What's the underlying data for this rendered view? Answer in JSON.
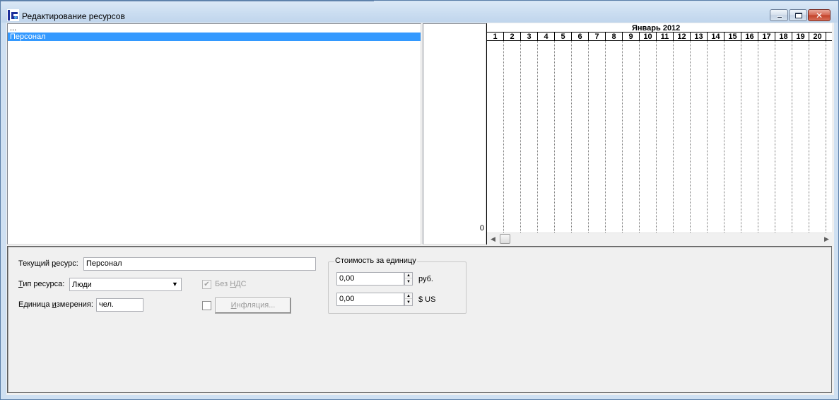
{
  "window": {
    "title": "Редактирование ресурсов"
  },
  "resource_list": {
    "items": [
      {
        "label": "...",
        "selected": false
      },
      {
        "label": "Персонал",
        "selected": true
      }
    ]
  },
  "value_column": {
    "zero_label": "0"
  },
  "gantt": {
    "month_label": "Январь 2012",
    "days": [
      "1",
      "2",
      "3",
      "4",
      "5",
      "6",
      "7",
      "8",
      "9",
      "10",
      "11",
      "12",
      "13",
      "14",
      "15",
      "16",
      "17",
      "18",
      "19",
      "20",
      "2"
    ]
  },
  "details": {
    "current_resource_label": "Текущий ресурс:",
    "current_resource_value": "Персонал",
    "resource_type_label": "Тип ресурса:",
    "resource_type_value": "Люди",
    "unit_label": "Единица измерения:",
    "unit_value": "чел.",
    "vat_checkbox_label": "Без НДС",
    "vat_checked": true,
    "inflation_checked": false,
    "inflation_button_label": "Инфляция...",
    "cost_group_title": "Стоимость за единицу",
    "cost_rub_value": "0,00",
    "cost_rub_unit": "руб.",
    "cost_usd_value": "0,00",
    "cost_usd_unit": "$ US"
  },
  "colors": {
    "selection": "#3399ff",
    "title_gradient": "#c9dcf0",
    "close_button": "#c24128"
  },
  "icons": {
    "app": "app-icon",
    "minimize": "minimize-icon",
    "maximize": "maximize-icon",
    "close": "close-icon",
    "dropdown": "chevron-down-icon",
    "spin_up": "arrow-up-icon",
    "spin_down": "arrow-down-icon",
    "scroll_left": "arrow-left-icon",
    "scroll_right": "arrow-right-icon"
  }
}
